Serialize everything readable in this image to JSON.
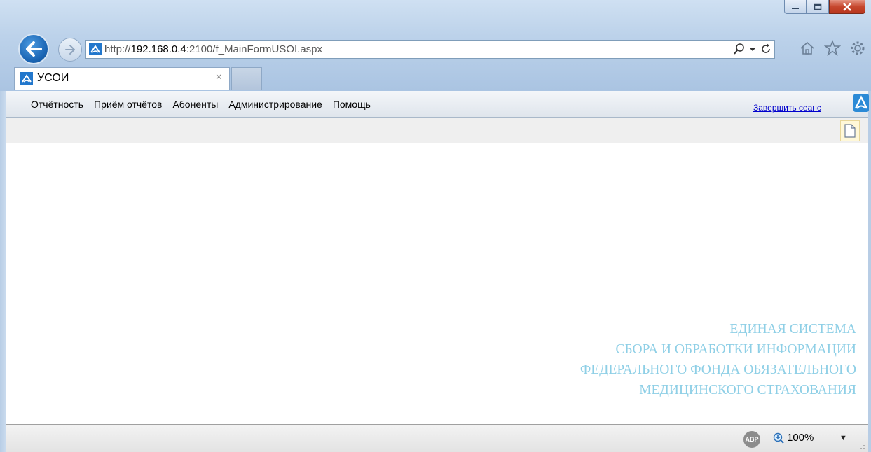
{
  "browser": {
    "address": {
      "scheme": "http://",
      "host": "192.168.0.4",
      "rest": ":2100/f_MainFormUSOI.aspx"
    },
    "tab": {
      "title": "УСОИ",
      "close": "×"
    }
  },
  "menu": {
    "items": [
      "Отчётность",
      "Приём отчётов",
      "Абоненты",
      "Администрирование",
      "Помощь"
    ],
    "logout": "Завершить сеанс"
  },
  "slogan": {
    "lines": [
      "ЕДИНАЯ СИСТЕМА",
      "СБОРА И ОБРАБОТКИ ИНФОРМАЦИИ",
      "ФЕДЕРАЛЬНОГО ФОНДА ОБЯЗАТЕЛЬНОГО",
      "МЕДИЦИНСКОГО СТРАХОВАНИЯ"
    ],
    "color": "#8ecfe6"
  },
  "statusbar": {
    "abp": "ABP",
    "zoom": "100%"
  },
  "colors": {
    "accent": "#2277cc",
    "close_button": "#c6472e",
    "link": "#0000cc"
  }
}
